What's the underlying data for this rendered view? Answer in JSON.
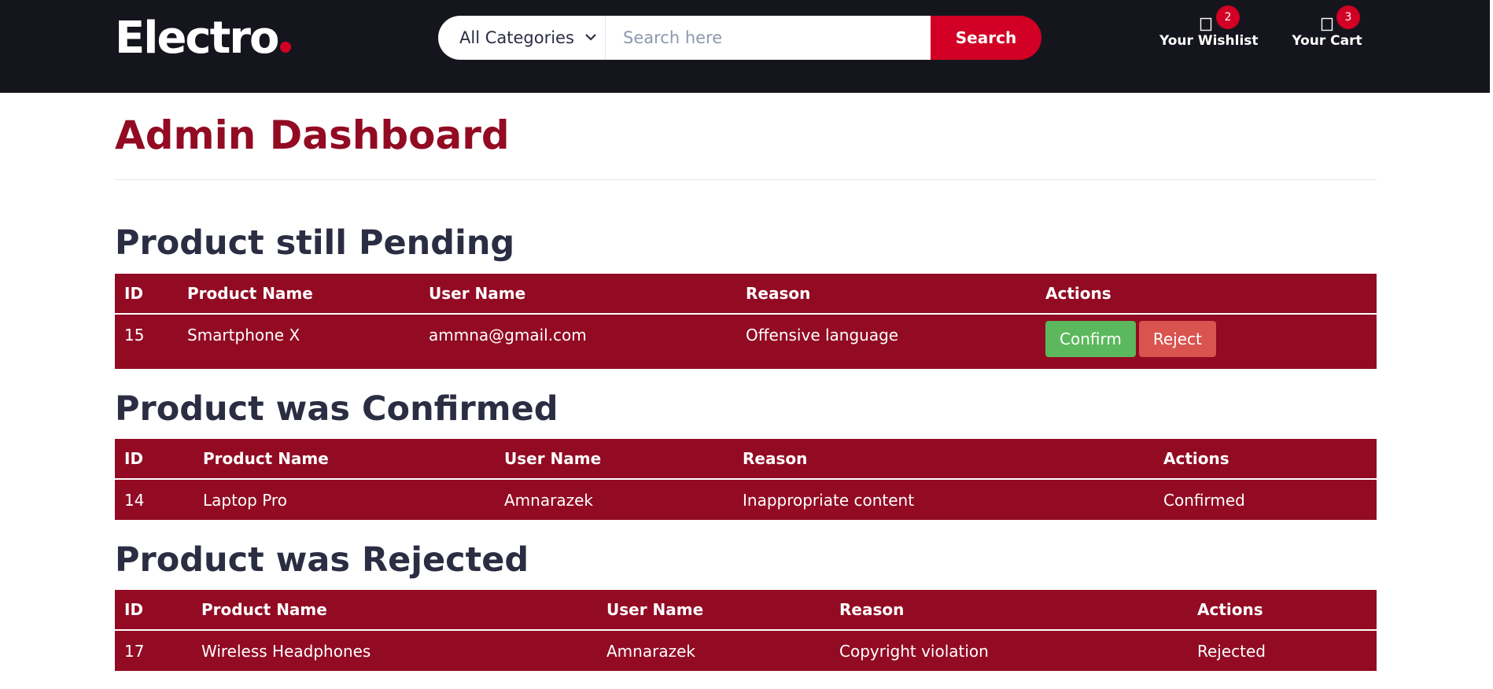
{
  "colors": {
    "header_bg": "#15161d",
    "accent": "#d10024",
    "table_bg": "#920b23",
    "title": "#920b23",
    "confirm": "#5cb85c",
    "reject": "#d9534f"
  },
  "header": {
    "logo_text": "Electro",
    "category_select": {
      "selected": "All Categories"
    },
    "search": {
      "placeholder": "Search here",
      "value": "",
      "button_label": "Search"
    },
    "wishlist": {
      "label": "Your Wishlist",
      "count": "2",
      "icon": "heart-icon"
    },
    "cart": {
      "label": "Your Cart",
      "count": "3",
      "icon": "shopping-cart-icon"
    }
  },
  "page": {
    "title": "Admin Dashboard"
  },
  "pending": {
    "title": "Product still Pending",
    "columns": [
      "ID",
      "Product Name",
      "User Name",
      "Reason",
      "Actions"
    ],
    "rows": [
      {
        "id": "15",
        "product_name": "Smartphone X",
        "user_name": "ammna@gmail.com",
        "reason": "Offensive language",
        "confirm_label": "Confirm",
        "reject_label": "Reject"
      }
    ]
  },
  "confirmed": {
    "title": "Product was Confirmed",
    "columns": [
      "ID",
      "Product Name",
      "User Name",
      "Reason",
      "Actions"
    ],
    "rows": [
      {
        "id": "14",
        "product_name": "Laptop Pro",
        "user_name": "Amnarazek",
        "reason": "Inappropriate content",
        "action": "Confirmed"
      }
    ]
  },
  "rejected": {
    "title": "Product was Rejected",
    "columns": [
      "ID",
      "Product Name",
      "User Name",
      "Reason",
      "Actions"
    ],
    "rows": [
      {
        "id": "17",
        "product_name": "Wireless Headphones",
        "user_name": "Amnarazek",
        "reason": "Copyright violation",
        "action": "Rejected"
      }
    ]
  }
}
